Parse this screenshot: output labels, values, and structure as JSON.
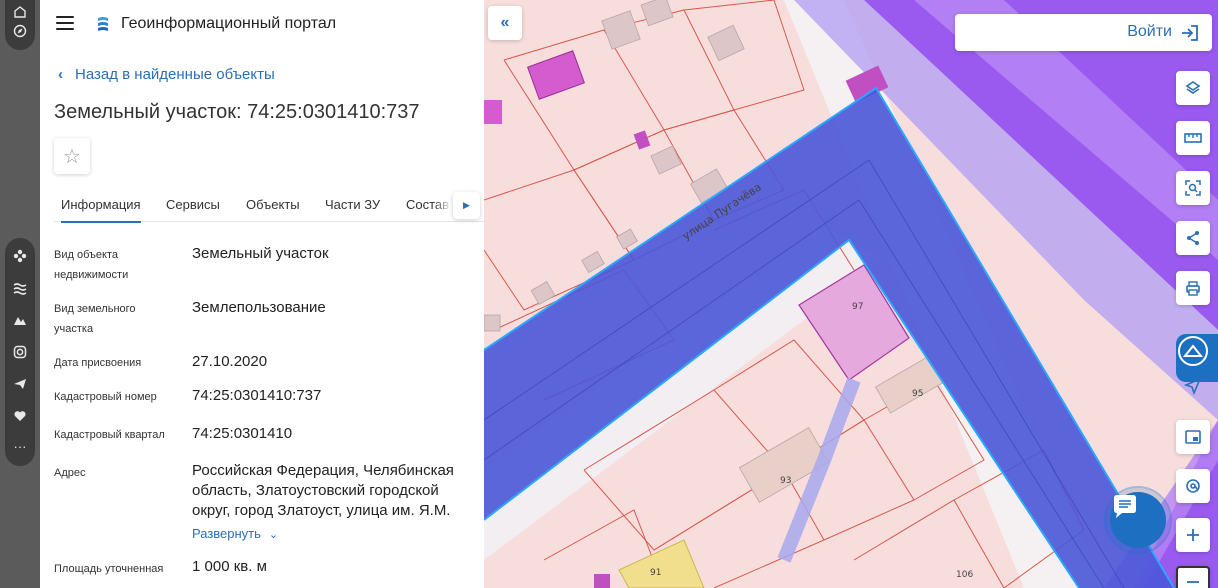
{
  "rail": {
    "icons": [
      "home-icon",
      "compass-icon",
      "flower-icon",
      "waves-icon",
      "mountain-icon",
      "camera-icon",
      "send-icon",
      "heart-icon",
      "more-icon"
    ],
    "more_label": "···"
  },
  "header": {
    "app_title": "Геоинформационный портал"
  },
  "nav": {
    "back_label": "Назад в найденные объекты"
  },
  "object": {
    "title": "Земельный участок: 74:25:0301410:737"
  },
  "tabs": [
    {
      "label": "Информация",
      "active": true
    },
    {
      "label": "Сервисы",
      "active": false
    },
    {
      "label": "Объекты",
      "active": false
    },
    {
      "label": "Части ЗУ",
      "active": false
    },
    {
      "label": "Состав",
      "active": false
    }
  ],
  "fields": [
    {
      "label": "Вид объекта недвижимости",
      "value": "Земельный участок"
    },
    {
      "label": "Вид земельного участка",
      "value": "Землепользование"
    },
    {
      "label": "Дата присвоения",
      "value": "27.10.2020"
    },
    {
      "label": "Кадастровый номер",
      "value": "74:25:0301410:737"
    },
    {
      "label": "Кадастровый квартал",
      "value": "74:25:0301410"
    },
    {
      "label": "Адрес",
      "value": "Российская Федерация, Челябинская область, Златоустовский городской округ, город Златоуст, улица им. Я.М."
    },
    {
      "label": "Площадь уточненная",
      "value": "1 000 кв. м"
    }
  ],
  "expand_label": "Развернуть",
  "map": {
    "login_label": "Войти",
    "street_label": "улица Пугачёва",
    "house_numbers": [
      "97",
      "95",
      "93",
      "91",
      "106"
    ],
    "tools": [
      "layers-icon",
      "ruler-icon",
      "search-area-icon",
      "share-icon",
      "print-icon",
      "locate-icon",
      "minimap-icon",
      "address-search-icon",
      "zoom-in-icon",
      "zoom-out-icon"
    ],
    "colors": {
      "parcel_fill": "#f6d7d5",
      "parcel_line": "#d9584e",
      "selection": "#4a56d8",
      "zone_violet": "#9a5af0",
      "accent": "#2b6fb5"
    }
  }
}
